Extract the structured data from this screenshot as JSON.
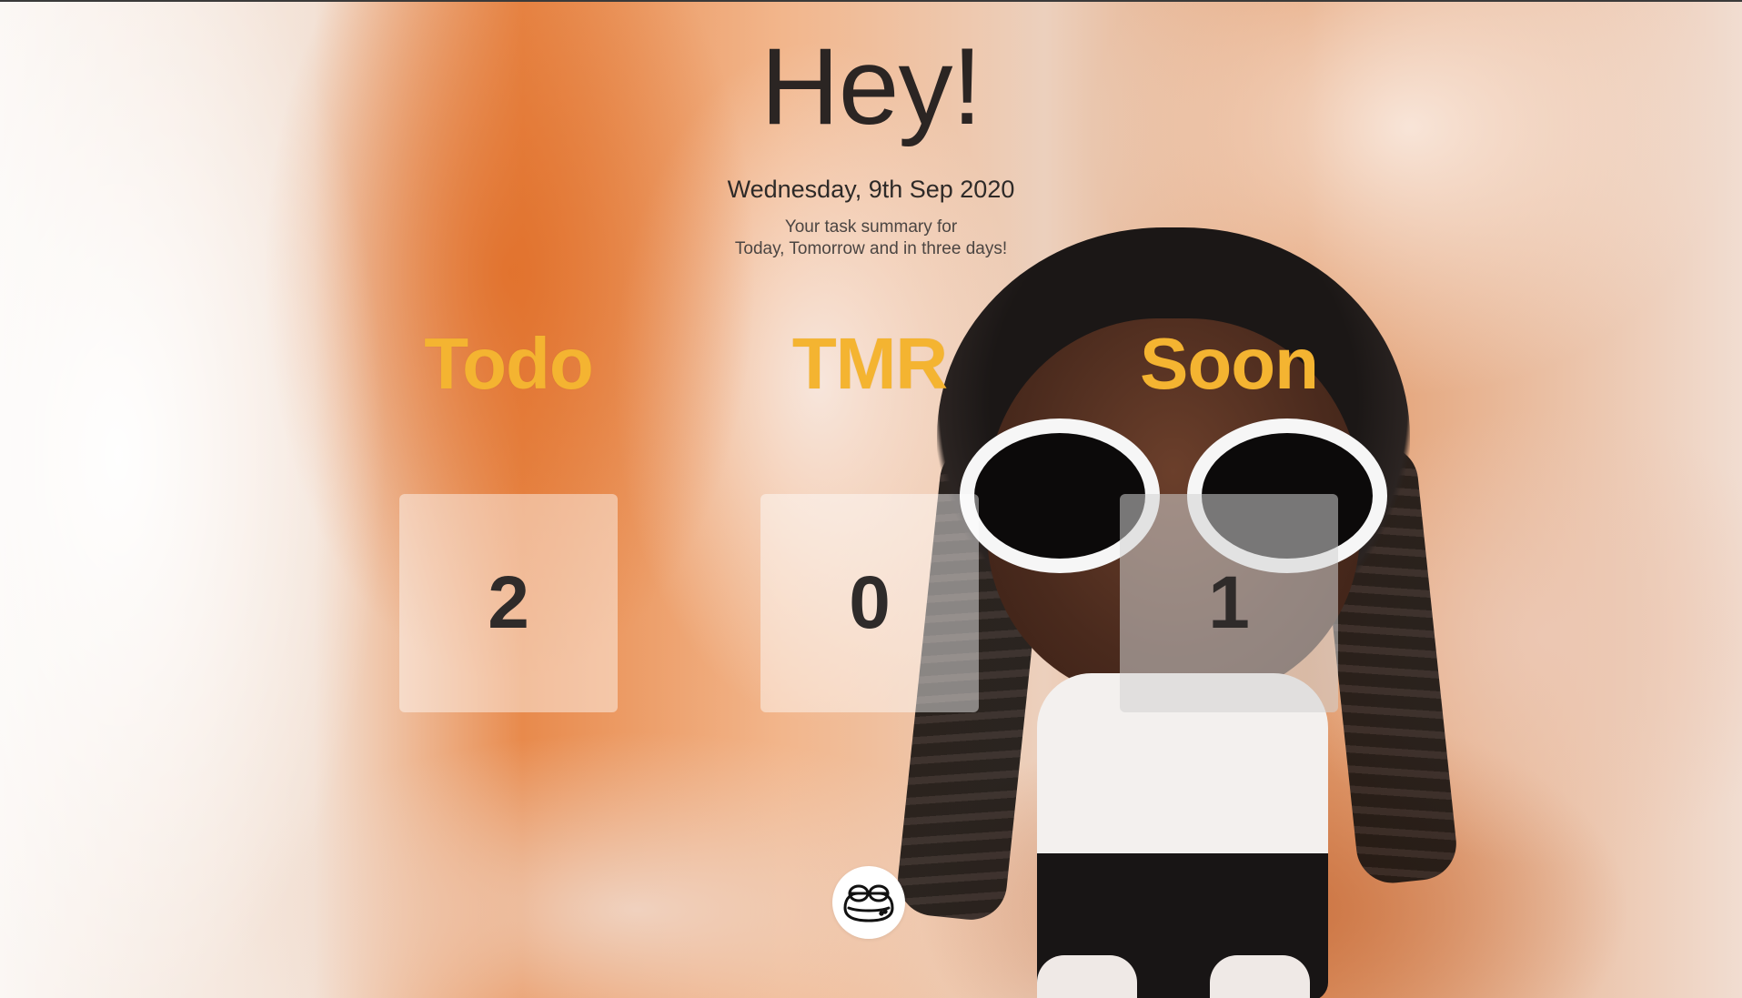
{
  "greeting": "Hey!",
  "date": "Wednesday, 9th Sep 2020",
  "summary": {
    "line1": "Your task summary for",
    "line2": "Today, Tomorrow and in three days!"
  },
  "columns": [
    {
      "label": "Todo",
      "count": "2"
    },
    {
      "label": "TMR",
      "count": "0"
    },
    {
      "label": "Soon",
      "count": "1"
    }
  ],
  "colors": {
    "label": "#f4b431",
    "count": "#2f2b2a",
    "heading": "#2b2523"
  },
  "icons": {
    "mascot": "frog-face-icon"
  }
}
